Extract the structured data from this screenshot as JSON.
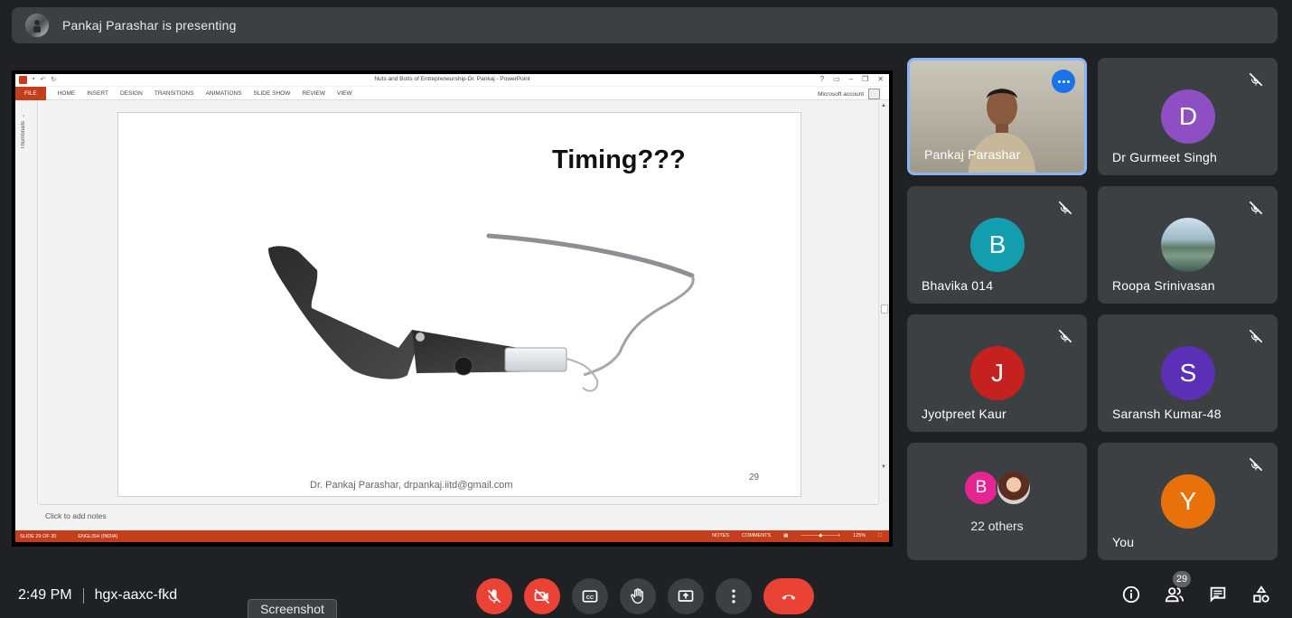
{
  "banner": {
    "text": "Pankaj Parashar is presenting"
  },
  "powerpoint": {
    "window_title": "Nuts and Bolts of Entrepreneurship-Dr. Pankaj - PowerPoint",
    "ribbon_tabs": [
      "FILE",
      "HOME",
      "INSERT",
      "DESIGN",
      "TRANSITIONS",
      "ANIMATIONS",
      "SLIDE SHOW",
      "REVIEW",
      "VIEW"
    ],
    "account": "Microsoft account",
    "thumbnails_label": "Thumbnails",
    "slide": {
      "title": "Timing???",
      "footer": "Dr. Pankaj Parashar, drpankaj.iitd@gmail.com",
      "number": "29"
    },
    "notes_placeholder": "Click to add notes",
    "status": {
      "slide": "SLIDE 29 OF 30",
      "language": "ENGLISH (INDIA)",
      "notes": "NOTES",
      "comments": "COMMENTS",
      "zoom": "125%"
    }
  },
  "participants": [
    {
      "name": "Pankaj Parashar",
      "type": "video",
      "speaking": true
    },
    {
      "name": "Dr Gurmeet Singh",
      "initial": "D",
      "color": "#8e4fc3",
      "muted": true
    },
    {
      "name": "Bhavika 014",
      "initial": "B",
      "color": "#129eaf",
      "muted": true
    },
    {
      "name": "Roopa Srinivasan",
      "type": "photo",
      "muted": true
    },
    {
      "name": "Jyotpreet Kaur",
      "initial": "J",
      "color": "#c5221f",
      "muted": true
    },
    {
      "name": "Saransh Kumar-48",
      "initial": "S",
      "color": "#5b30b6",
      "muted": true
    },
    {
      "others_label": "22 others",
      "initial": "B",
      "color": "#e52592"
    },
    {
      "name": "You",
      "initial": "Y",
      "color": "#e8710a",
      "muted": true
    }
  ],
  "footer": {
    "time": "2:49 PM",
    "meeting_code": "hgx-aaxc-fkd",
    "tooltip": "Screenshot",
    "people_count": "29"
  },
  "colors": {
    "end_call": "#ea4335",
    "speaker_border": "#8ab4f8",
    "tile_bg": "#3c4043"
  }
}
